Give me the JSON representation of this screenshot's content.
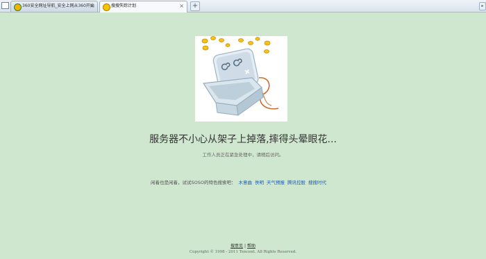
{
  "tabs": [
    {
      "label": "360安全网址导航_安全上网从360开始",
      "active": false
    },
    {
      "label": "搜搜失踪计划",
      "active": true
    }
  ],
  "new_tab_symbol": "+",
  "close_symbol": "×",
  "main": {
    "headline": "服务器不小心从架子上掉落,摔得头晕眼花...",
    "subline": "工作人员正在紧急处理中，请稍后访问。",
    "suggest_prefix": "闲着也是闲着，试试SOSO的特色搜索吧：",
    "suggest_links": [
      "木意曲",
      "佚明",
      "天气预报",
      "腾讯控股",
      "搜搜时代"
    ]
  },
  "footer": {
    "links": [
      "搜意见",
      "帮助"
    ],
    "separator": "|",
    "copyright": "Copyright © 1998 - 2011 Tencent. All Rights Reserved."
  },
  "colors": {
    "background": "#cfe6cf",
    "link": "#1a5fb4"
  },
  "icons": [
    "window-icon",
    "360-icon",
    "soso-icon",
    "close-icon",
    "plus-icon",
    "chevron-right-icon",
    "dizzy-server-illustration"
  ]
}
